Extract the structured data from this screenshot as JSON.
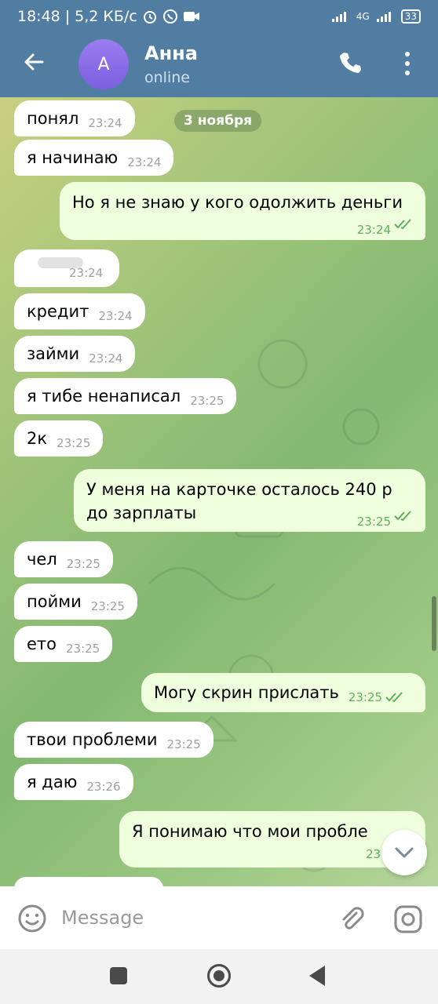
{
  "status_bar": {
    "time": "18:48",
    "speed": "5,2 КБ/с",
    "network": "4G",
    "battery": "33"
  },
  "header": {
    "avatar_letter": "А",
    "name": "Анна",
    "status": "online"
  },
  "date_chip": "3 ноября",
  "messages": [
    {
      "dir": "in",
      "text": "понял",
      "time": "23:24"
    },
    {
      "dir": "in",
      "text": "я начинаю",
      "time": "23:24"
    },
    {
      "dir": "out",
      "text": "Но я не знаю у кого одолжить деньги",
      "time": "23:24"
    },
    {
      "dir": "in",
      "text": "",
      "time": "23:24"
    },
    {
      "dir": "in",
      "text": "кредит",
      "time": "23:24"
    },
    {
      "dir": "in",
      "text": "займи",
      "time": "23:24"
    },
    {
      "dir": "in",
      "text": "я тибе ненаписал",
      "time": "23:25"
    },
    {
      "dir": "in",
      "text": "2к",
      "time": "23:25"
    },
    {
      "dir": "out",
      "text_line1": "У меня на карточке осталось 240 р",
      "text_line2": "до зарплаты",
      "time": "23:25"
    },
    {
      "dir": "in",
      "text": "чел",
      "time": "23:25"
    },
    {
      "dir": "in",
      "text": "пойми",
      "time": "23:25"
    },
    {
      "dir": "in",
      "text": "ето",
      "time": "23:25"
    },
    {
      "dir": "out",
      "text": "Могу скрин прислать",
      "time": "23:25"
    },
    {
      "dir": "in",
      "text": "твои проблеми",
      "time": "23:25"
    },
    {
      "dir": "in",
      "text": "я даю",
      "time": "23:26"
    },
    {
      "dir": "out",
      "text": "Я понимаю что мои пробле",
      "time": "23:"
    }
  ],
  "input": {
    "placeholder": "Message"
  },
  "colors": {
    "header": "#517da2",
    "out_bubble": "#effedd",
    "in_bubble": "#ffffff",
    "check": "#5fb05c"
  }
}
